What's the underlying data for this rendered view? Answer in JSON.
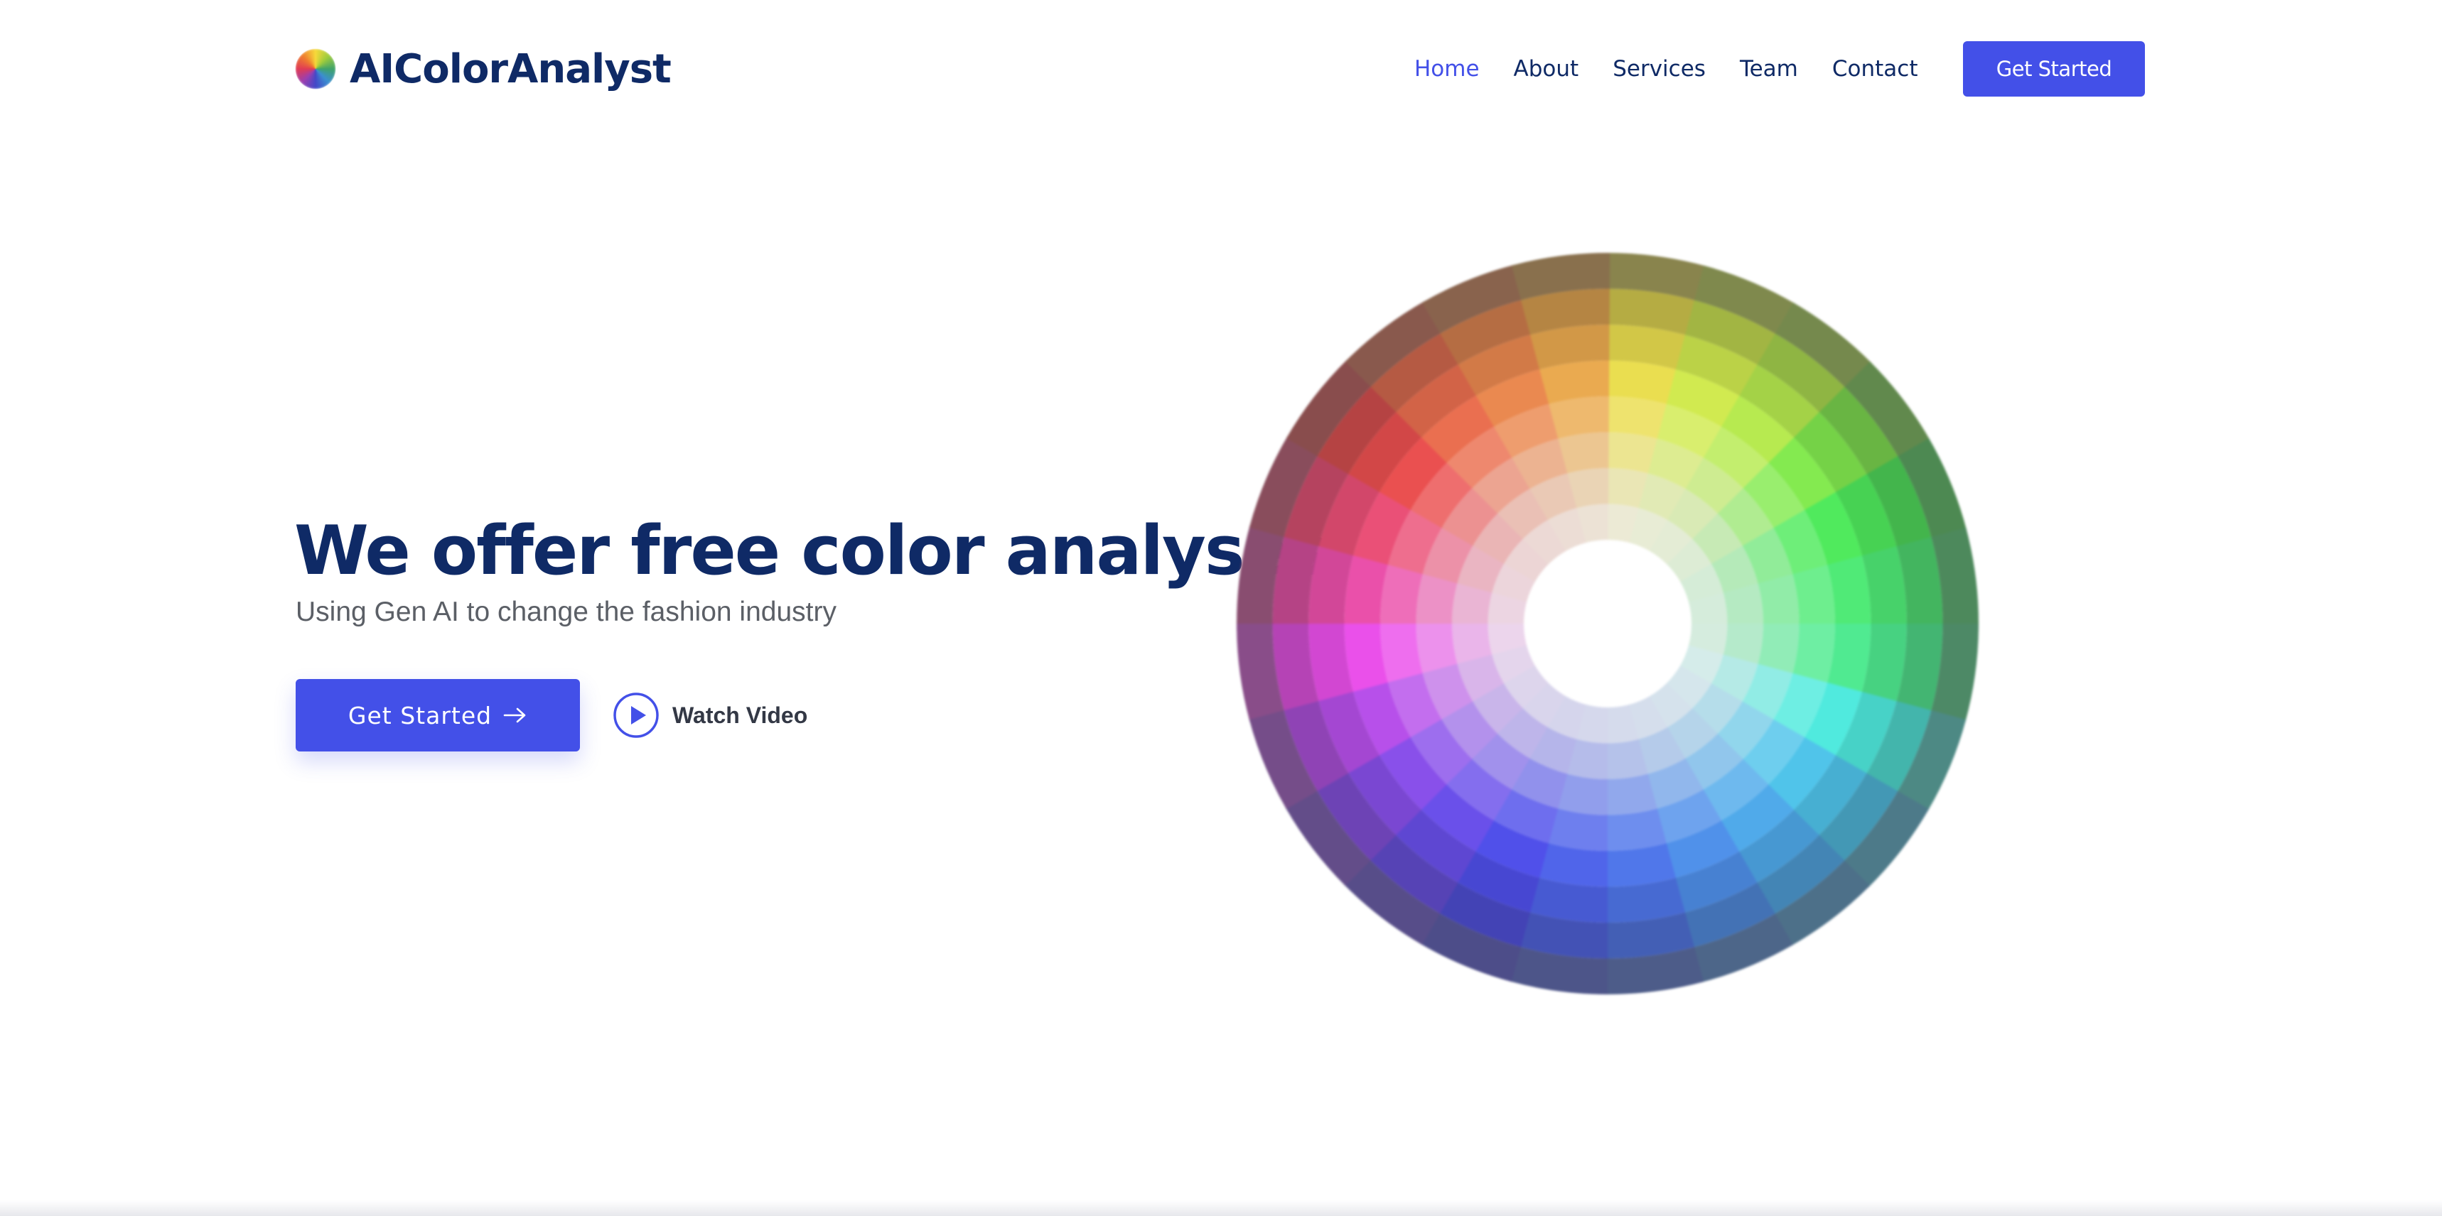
{
  "brand": {
    "name": "AIColorAnalyst",
    "logo_icon": "color-wheel-logo-icon"
  },
  "nav": {
    "items": [
      {
        "label": "Home",
        "active": true
      },
      {
        "label": "About",
        "active": false
      },
      {
        "label": "Services",
        "active": false
      },
      {
        "label": "Team",
        "active": false
      },
      {
        "label": "Contact",
        "active": false
      }
    ],
    "cta_label": "Get Started"
  },
  "hero": {
    "title": "We offer free color analyses",
    "subtitle": "Using Gen AI to change the fashion industry",
    "cta_label": "Get Started",
    "cta_icon": "arrow-right-icon",
    "video_label": "Watch Video",
    "video_icon": "play-circle-icon"
  },
  "colors": {
    "primary": "#4350e8",
    "heading": "#0f2a66",
    "subtitle": "#5b5f66",
    "background": "#ffffff"
  }
}
